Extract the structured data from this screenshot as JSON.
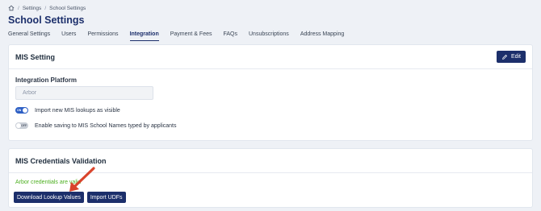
{
  "breadcrumb": {
    "items": [
      "Settings",
      "School Settings"
    ],
    "separator": "/"
  },
  "page": {
    "title": "School Settings"
  },
  "tabs": [
    {
      "label": "General Settings",
      "active": false
    },
    {
      "label": "Users",
      "active": false
    },
    {
      "label": "Permissions",
      "active": false
    },
    {
      "label": "Integration",
      "active": true
    },
    {
      "label": "Payment & Fees",
      "active": false
    },
    {
      "label": "FAQs",
      "active": false
    },
    {
      "label": "Unsubscriptions",
      "active": false
    },
    {
      "label": "Address Mapping",
      "active": false
    }
  ],
  "mis_setting": {
    "title": "MIS Setting",
    "edit_label": "Edit",
    "platform_label": "Integration Platform",
    "platform_value": "Arbor",
    "toggle1": {
      "state_label": "ON",
      "label": "Import new MIS lookups as visible"
    },
    "toggle2": {
      "state_label": "OFF",
      "label": "Enable saving to MIS School Names typed by applicants"
    }
  },
  "credentials": {
    "title": "MIS Credentials Validation",
    "status_text": "Arbor credentials are valid",
    "download_label": "Download Lookup Values",
    "import_label": "Import UDFs"
  },
  "colors": {
    "brand": "#1c2f6b",
    "toggle_on": "#2d5fc4",
    "valid_text": "#4caf1f",
    "annotation_arrow": "#d9442c"
  },
  "icons": [
    "home-icon",
    "pencil-icon",
    "annotation-arrow"
  ]
}
